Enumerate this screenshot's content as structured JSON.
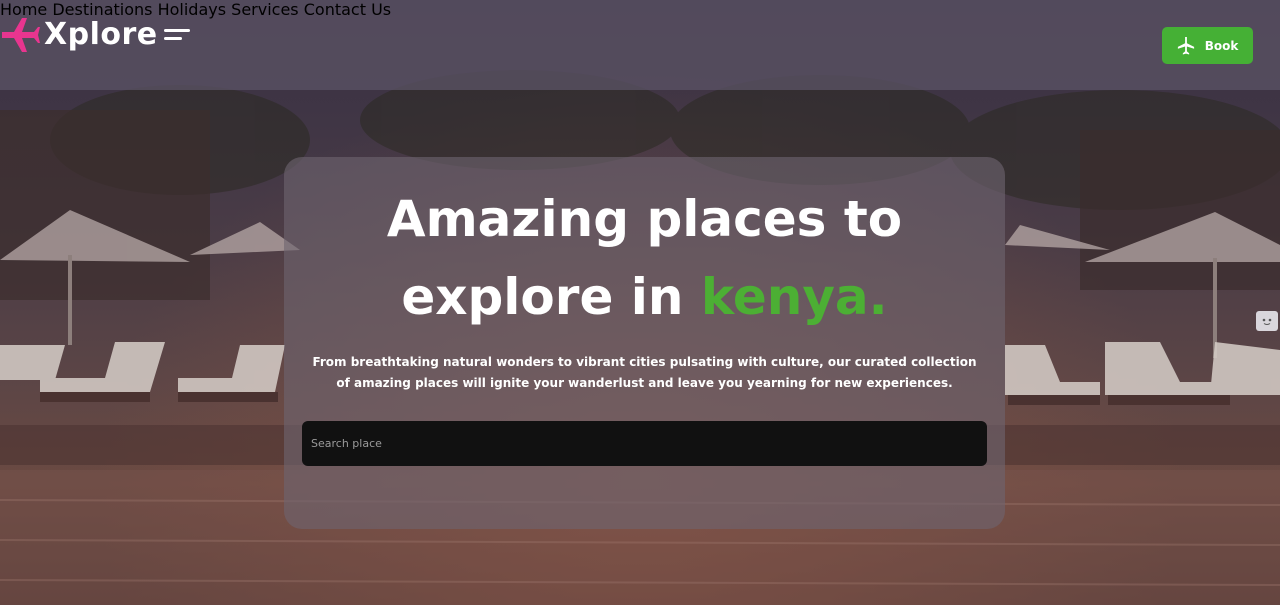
{
  "brand": {
    "name": "Xplore",
    "plane_color": "#e8358f"
  },
  "nav": {
    "items": [
      "Home",
      "Destinations",
      "Holidays",
      "Services",
      "Contact Us"
    ],
    "book_label": "Book",
    "book_color": "#45b035"
  },
  "hero": {
    "title_line1": "Amazing places to",
    "title_line2_prefix": "explore in ",
    "title_accent": "kenya.",
    "accent_color": "#4caf34",
    "description": "From breathtaking natural wonders to vibrant cities pulsating with culture, our curated collection of amazing places will ignite your wanderlust and leave you yearning for new experiences.",
    "search_placeholder": "Search place"
  },
  "icons": {
    "logo": "airplane-icon",
    "menu": "hamburger-menu-icon",
    "book": "airplane-icon",
    "side_widget": "face-icon"
  }
}
